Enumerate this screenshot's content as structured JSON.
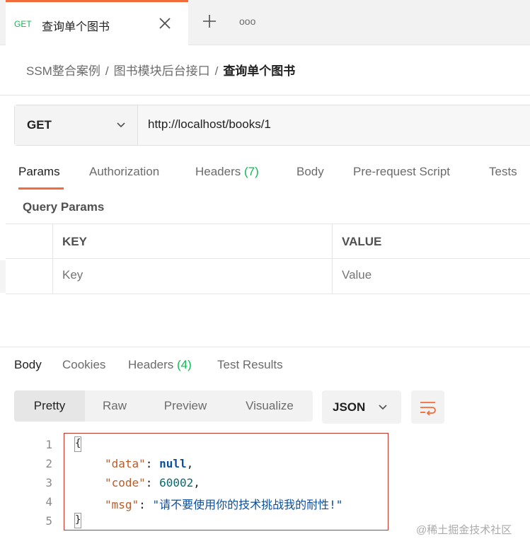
{
  "tab": {
    "method": "GET",
    "title": "查询单个图书",
    "more": "ooo"
  },
  "breadcrumb": {
    "items": [
      "SSM整合案例",
      "图书模块后台接口"
    ],
    "separator": "/",
    "current": "查询单个图书"
  },
  "request": {
    "method": "GET",
    "url": "http://localhost/books/1"
  },
  "request_tabs": {
    "params": "Params",
    "authorization": "Authorization",
    "headers": "Headers",
    "headers_count": "(7)",
    "body": "Body",
    "prerequest": "Pre-request Script",
    "tests": "Tests"
  },
  "query_params": {
    "title": "Query Params",
    "key_header": "KEY",
    "value_header": "VALUE",
    "key_placeholder": "Key",
    "value_placeholder": "Value"
  },
  "response_tabs": {
    "body": "Body",
    "cookies": "Cookies",
    "headers": "Headers",
    "headers_count": "(4)",
    "test_results": "Test Results"
  },
  "view_modes": {
    "pretty": "Pretty",
    "raw": "Raw",
    "preview": "Preview",
    "visualize": "Visualize"
  },
  "format": "JSON",
  "code": {
    "line_numbers": [
      "1",
      "2",
      "3",
      "4",
      "5"
    ],
    "open_brace": "{",
    "close_brace": "}",
    "data_key": "\"data\"",
    "data_value": "null",
    "code_key": "\"code\"",
    "code_value": "60002",
    "msg_key": "\"msg\"",
    "msg_value": "\"请不要使用你的技术挑战我的耐性!\"",
    "colon": ": ",
    "comma": ","
  },
  "watermark": "@稀土掘金技术社区",
  "colors": {
    "accent": "#f26b3a",
    "get_green": "#0cbb52",
    "highlight_border": "#c0392b"
  }
}
